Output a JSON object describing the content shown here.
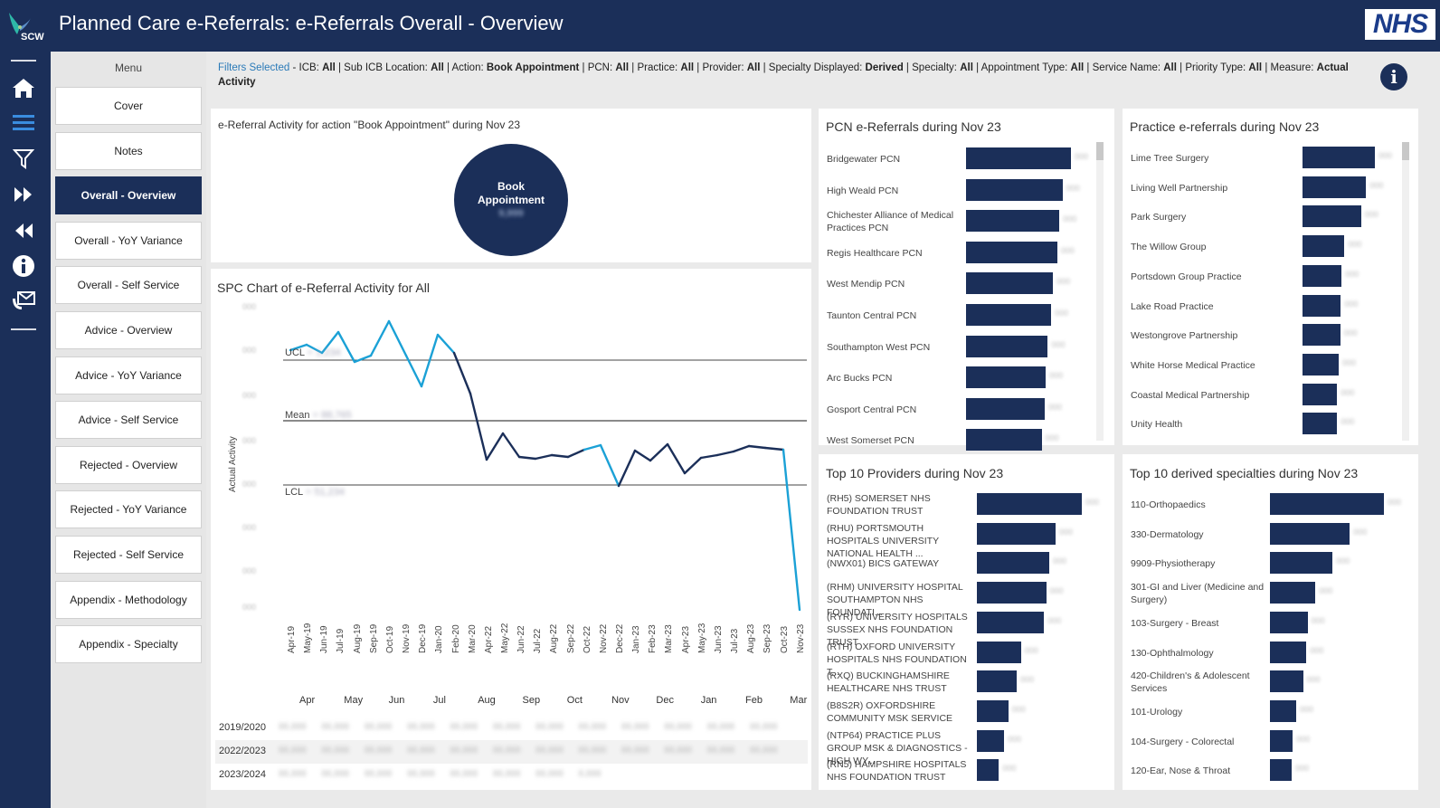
{
  "header": {
    "logo_text": "SCW",
    "title": "Planned Care e-Referrals: e-Referrals Overall - Overview",
    "nhs_logo": "NHS"
  },
  "sidebar": {
    "icons": [
      "home-icon",
      "menu-icon",
      "filter-icon",
      "fast-forward-icon",
      "rewind-icon",
      "info-icon",
      "mail-icon"
    ]
  },
  "menu": {
    "title": "Menu",
    "items": [
      {
        "label": "Cover",
        "active": false
      },
      {
        "label": "Notes",
        "active": false
      },
      {
        "label": "Overall - Overview",
        "active": true
      },
      {
        "label": "Overall - YoY Variance",
        "active": false
      },
      {
        "label": "Overall - Self Service",
        "active": false
      },
      {
        "label": "Advice - Overview",
        "active": false
      },
      {
        "label": "Advice - YoY Variance",
        "active": false
      },
      {
        "label": "Advice - Self Service",
        "active": false
      },
      {
        "label": "Rejected - Overview",
        "active": false
      },
      {
        "label": "Rejected - YoY Variance",
        "active": false
      },
      {
        "label": "Rejected - Self Service",
        "active": false
      },
      {
        "label": "Appendix - Methodology",
        "active": false
      },
      {
        "label": "Appendix - Specialty",
        "active": false
      }
    ]
  },
  "filters": {
    "prefix": "Filters Selected",
    "items": [
      {
        "name": "ICB",
        "value": "All"
      },
      {
        "name": "Sub ICB Location",
        "value": "All"
      },
      {
        "name": "Action",
        "value": "Book Appointment"
      },
      {
        "name": "PCN",
        "value": "All"
      },
      {
        "name": "Practice",
        "value": "All"
      },
      {
        "name": "Provider",
        "value": "All"
      },
      {
        "name": "Specialty Displayed",
        "value": "Derived"
      },
      {
        "name": "Specialty",
        "value": "All"
      },
      {
        "name": "Appointment Type",
        "value": "All"
      },
      {
        "name": "Service Name",
        "value": "All"
      },
      {
        "name": "Priority Type",
        "value": "All"
      },
      {
        "name": "Measure",
        "value": "Actual Activity"
      }
    ]
  },
  "activity_card": {
    "title": "e-Referral Activity for action \"Book Appointment\" during Nov 23",
    "circle_line1": "Book",
    "circle_line2": "Appointment"
  },
  "spc": {
    "title": "SPC Chart of e-Referral Activity for All",
    "ylabel": "Actual Activity",
    "ucl_label": "UCL",
    "mean_label": "Mean",
    "lcl_label": "LCL",
    "months": [
      "Apr-19",
      "May-19",
      "Jun-19",
      "Jul-19",
      "Aug-19",
      "Sep-19",
      "Oct-19",
      "Nov-19",
      "Dec-19",
      "Jan-20",
      "Feb-20",
      "Mar-20",
      "Apr-22",
      "May-22",
      "Jun-22",
      "Jul-22",
      "Aug-22",
      "Sep-22",
      "Oct-22",
      "Nov-22",
      "Dec-22",
      "Jan-23",
      "Feb-23",
      "Mar-23",
      "Apr-23",
      "May-23",
      "Jun-23",
      "Jul-23",
      "Aug-23",
      "Sep-23",
      "Oct-23",
      "Nov-23"
    ],
    "table_months": [
      "Apr",
      "May",
      "Jun",
      "Jul",
      "Aug",
      "Sep",
      "Oct",
      "Nov",
      "Dec",
      "Jan",
      "Feb",
      "Mar"
    ],
    "table_years": [
      "2019/2020",
      "2022/2023",
      "2023/2024"
    ]
  },
  "pcn": {
    "title": "PCN e-Referrals during Nov 23",
    "items": [
      {
        "label": "Bridgewater PCN",
        "value": 1.0
      },
      {
        "label": "High Weald PCN",
        "value": 0.92
      },
      {
        "label": "Chichester Alliance of Medical Practices PCN",
        "value": 0.89
      },
      {
        "label": "Regis Healthcare PCN",
        "value": 0.87
      },
      {
        "label": "West Mendip PCN",
        "value": 0.83
      },
      {
        "label": "Taunton Central PCN",
        "value": 0.81
      },
      {
        "label": "Southampton West PCN",
        "value": 0.78
      },
      {
        "label": "Arc Bucks PCN",
        "value": 0.76
      },
      {
        "label": "Gosport Central PCN",
        "value": 0.75
      },
      {
        "label": "West Somerset PCN",
        "value": 0.72
      }
    ]
  },
  "practice": {
    "title": "Practice e-referrals during Nov 23",
    "items": [
      {
        "label": "Lime Tree Surgery",
        "value": 1.0
      },
      {
        "label": "Living Well Partnership",
        "value": 0.88
      },
      {
        "label": "Park Surgery",
        "value": 0.81
      },
      {
        "label": "The Willow Group",
        "value": 0.58
      },
      {
        "label": "Portsdown Group Practice",
        "value": 0.54
      },
      {
        "label": "Lake Road Practice",
        "value": 0.53
      },
      {
        "label": "Westongrove Partnership",
        "value": 0.52
      },
      {
        "label": "White Horse Medical Practice",
        "value": 0.5
      },
      {
        "label": "Coastal Medical Partnership",
        "value": 0.48
      },
      {
        "label": "Unity Health",
        "value": 0.48
      }
    ]
  },
  "providers": {
    "title": "Top 10 Providers during Nov 23",
    "items": [
      {
        "label": "(RH5) SOMERSET NHS FOUNDATION TRUST",
        "value": 1.0
      },
      {
        "label": "(RHU) PORTSMOUTH HOSPITALS UNIVERSITY NATIONAL HEALTH ...",
        "value": 0.75
      },
      {
        "label": "(NWX01) BICS GATEWAY",
        "value": 0.69
      },
      {
        "label": "(RHM) UNIVERSITY HOSPITAL SOUTHAMPTON NHS FOUNDATI...",
        "value": 0.66
      },
      {
        "label": "(RYR) UNIVERSITY HOSPITALS SUSSEX NHS FOUNDATION TRUST",
        "value": 0.64
      },
      {
        "label": "(RTH) OXFORD UNIVERSITY HOSPITALS NHS FOUNDATION T...",
        "value": 0.42
      },
      {
        "label": "(RXQ) BUCKINGHAMSHIRE HEALTHCARE NHS TRUST",
        "value": 0.38
      },
      {
        "label": "(B8S2R) OXFORDSHIRE COMMUNITY MSK SERVICE",
        "value": 0.3
      },
      {
        "label": "(NTP64) PRACTICE PLUS GROUP MSK & DIAGNOSTICS - HIGH WY...",
        "value": 0.26
      },
      {
        "label": "(RN5) HAMPSHIRE HOSPITALS NHS FOUNDATION TRUST",
        "value": 0.21
      }
    ]
  },
  "specialties": {
    "title": "Top 10 derived specialties during Nov 23",
    "items": [
      {
        "label": "110-Orthopaedics",
        "value": 1.0
      },
      {
        "label": "330-Dermatology",
        "value": 0.7
      },
      {
        "label": "9909-Physiotherapy",
        "value": 0.55
      },
      {
        "label": "301-GI and Liver (Medicine and Surgery)",
        "value": 0.4
      },
      {
        "label": "103-Surgery - Breast",
        "value": 0.33
      },
      {
        "label": "130-Ophthalmology",
        "value": 0.32
      },
      {
        "label": "420-Children's & Adolescent Services",
        "value": 0.29
      },
      {
        "label": "101-Urology",
        "value": 0.23
      },
      {
        "label": "104-Surgery - Colorectal",
        "value": 0.2
      },
      {
        "label": "120-Ear, Nose & Throat",
        "value": 0.19
      }
    ]
  }
}
